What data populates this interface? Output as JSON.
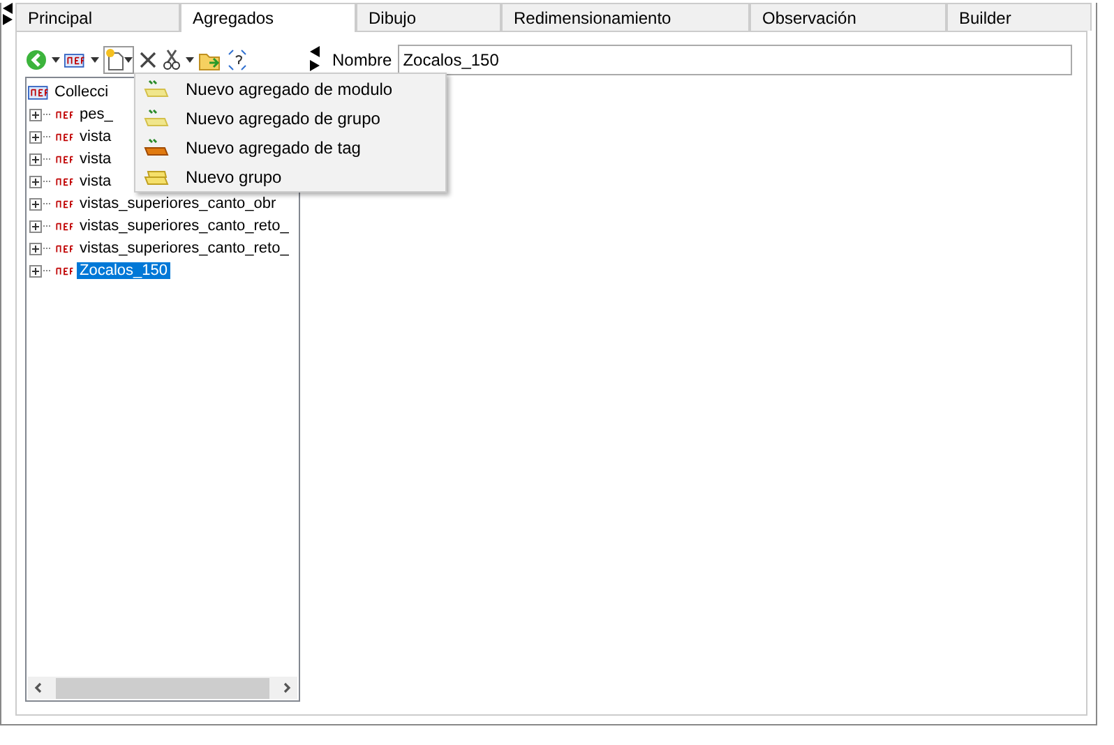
{
  "tabs": [
    {
      "label": "Principal",
      "selected": false
    },
    {
      "label": "Agregados",
      "selected": true
    },
    {
      "label": "Dibujo",
      "selected": false
    },
    {
      "label": "Redimensionamiento",
      "selected": false
    },
    {
      "label": "Observación",
      "selected": false
    },
    {
      "label": "Builder",
      "selected": false
    }
  ],
  "name_field": {
    "label": "Nombre",
    "value": "Zocalos_150"
  },
  "tree": {
    "root": "Collecci",
    "children": [
      {
        "label": "pes_",
        "selected": false
      },
      {
        "label": "vista",
        "selected": false
      },
      {
        "label": "vista",
        "selected": false
      },
      {
        "label": "vista",
        "selected": false
      },
      {
        "label": "vistas_superiores_canto_obr",
        "selected": false
      },
      {
        "label": "vistas_superiores_canto_reto_",
        "selected": false
      },
      {
        "label": "vistas_superiores_canto_reto_",
        "selected": false
      },
      {
        "label": "Zocalos_150",
        "selected": true
      }
    ]
  },
  "menu": {
    "items": [
      {
        "label": "Nuevo agregado de modulo",
        "kind": "module"
      },
      {
        "label": "Nuevo agregado de grupo",
        "kind": "group"
      },
      {
        "label": "Nuevo agregado de tag",
        "kind": "tag"
      },
      {
        "label": "Nuevo grupo",
        "kind": "folder"
      }
    ]
  }
}
